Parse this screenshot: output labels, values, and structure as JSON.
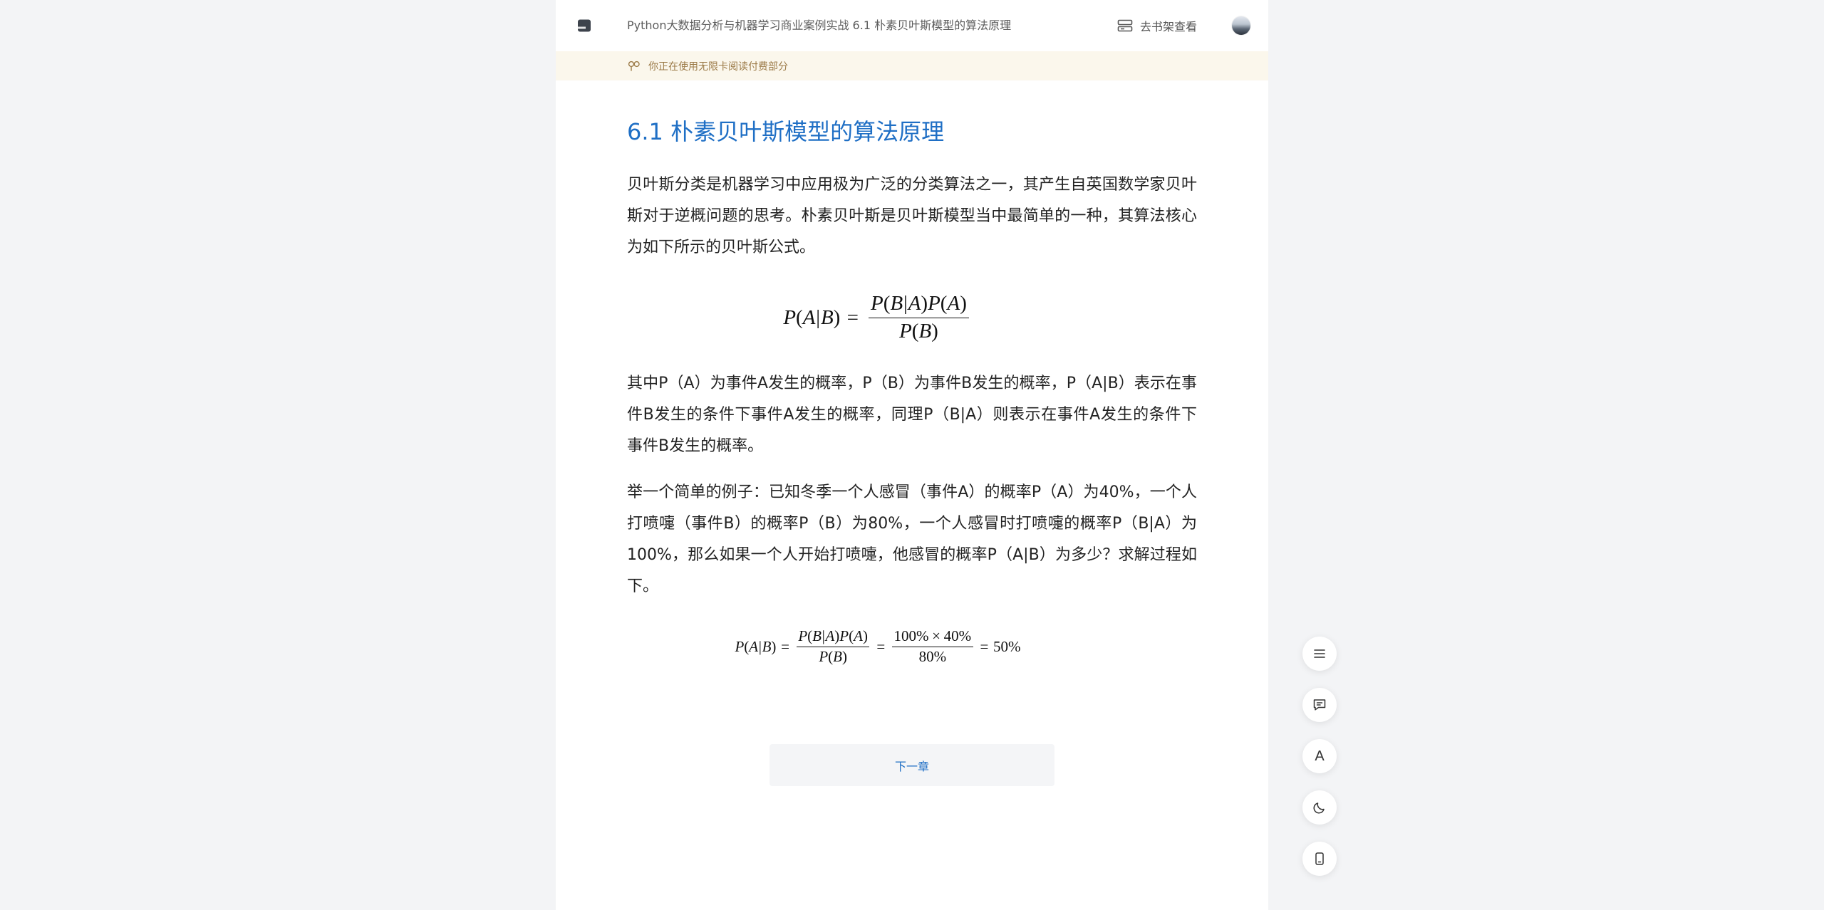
{
  "header": {
    "logo_icon": "book-logo-icon",
    "title": "Python大数据分析与机器学习商业案例实战 6.1 朴素贝叶斯模型的算法原理",
    "shelf_icon": "bookshelf-icon",
    "shelf_label": "去书架查看"
  },
  "notice": {
    "icon": "unlimited-card-icon",
    "text": "你正在使用无限卡阅读付费部分"
  },
  "chapter": {
    "title": "6.1 朴素贝叶斯模型的算法原理",
    "paragraphs": [
      "贝叶斯分类是机器学习中应用极为广泛的分类算法之一，其产生自英国数学家贝叶斯对于逆概问题的思考。朴素贝叶斯是贝叶斯模型当中最简单的一种，其算法核心为如下所示的贝叶斯公式。",
      "其中P（A）为事件A发生的概率，P（B）为事件B发生的概率，P（A|B）表示在事件B发生的条件下事件A发生的概率，同理P（B|A）则表示在事件A发生的条件下事件B发生的概率。",
      "举一个简单的例子：已知冬季一个人感冒（事件A）的概率P（A）为40%，一个人打喷嚏（事件B）的概率P（B）为80%，一个人感冒时打喷嚏的概率P（B|A）为100%，那么如果一个人开始打喷嚏，他感冒的概率P（A|B）为多少？求解过程如下。"
    ],
    "formula_1": {
      "lhs": "P(A|B)",
      "eq": "=",
      "num": "P(B|A)P(A)",
      "den": "P(B)"
    },
    "formula_2": {
      "lhs": "P(A|B)",
      "eq": "=",
      "num_1": "P(B|A)P(A)",
      "den_1": "P(B)",
      "num_2": "100%×40%",
      "den_2": "80%",
      "result": "50%"
    },
    "next_label": "下一章"
  },
  "toolbar": {
    "icons": [
      "list-icon",
      "comment-icon",
      "font-icon",
      "moon-icon",
      "phone-icon"
    ],
    "font_glyph": "A"
  },
  "colors": {
    "page_bg": "#f3f4f6",
    "accent": "#1f6fc5",
    "notice_bg": "#fbf7ec",
    "notice_text": "#9b7a47",
    "text": "#222222"
  }
}
